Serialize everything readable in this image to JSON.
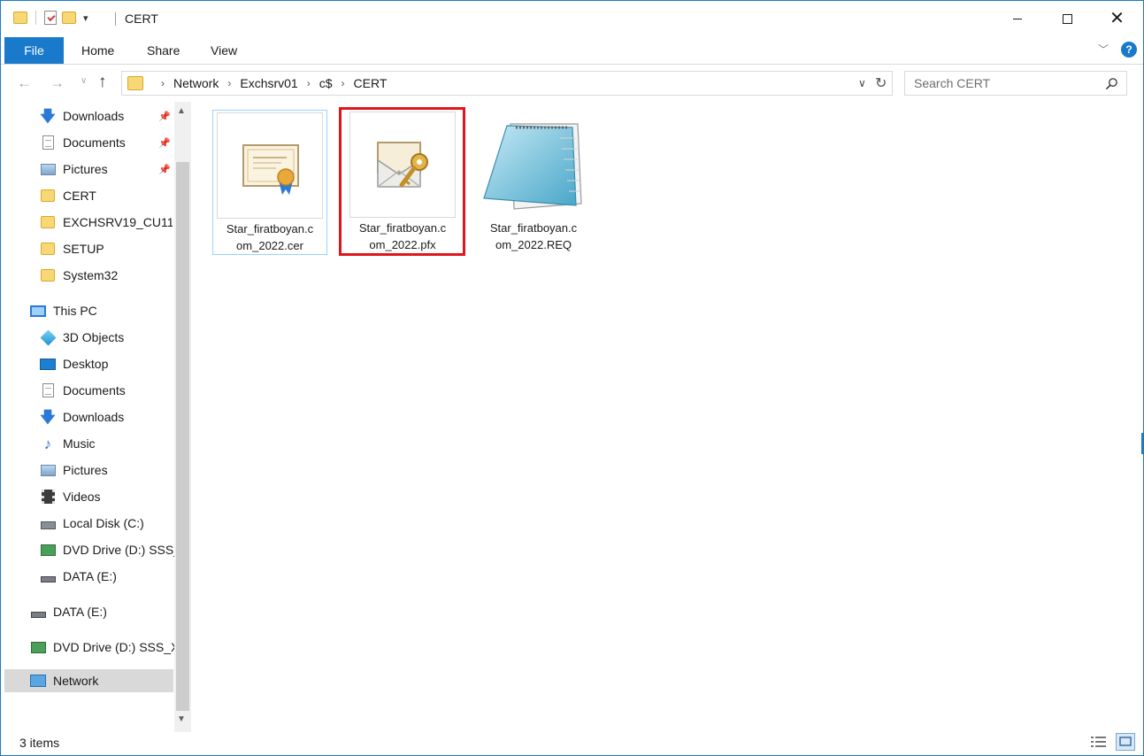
{
  "window": {
    "title": "CERT",
    "controls": {
      "minimize": "Minimize",
      "maximize": "Maximize",
      "close": "Close"
    }
  },
  "ribbon": {
    "tabs": [
      "File",
      "Home",
      "Share",
      "View"
    ],
    "accent_color": "#1979ca",
    "help_glyph": "?"
  },
  "address": {
    "crumbs": [
      "Network",
      "Exchsrv01",
      "c$",
      "CERT"
    ]
  },
  "search": {
    "placeholder": "Search CERT"
  },
  "nav": {
    "quick_access": [
      {
        "label": "Downloads",
        "icon": "downloads-icon",
        "pinned": true
      },
      {
        "label": "Documents",
        "icon": "documents-icon",
        "pinned": true
      },
      {
        "label": "Pictures",
        "icon": "pictures-icon",
        "pinned": true
      },
      {
        "label": "CERT",
        "icon": "folder-icon"
      },
      {
        "label": "EXCHSRV19_CU11",
        "icon": "folder-icon"
      },
      {
        "label": "SETUP",
        "icon": "folder-icon"
      },
      {
        "label": "System32",
        "icon": "folder-icon"
      }
    ],
    "this_pc": {
      "label": "This PC",
      "items": [
        {
          "label": "3D Objects",
          "icon": "3d-objects-icon"
        },
        {
          "label": "Desktop",
          "icon": "desktop-icon"
        },
        {
          "label": "Documents",
          "icon": "documents-icon"
        },
        {
          "label": "Downloads",
          "icon": "downloads-icon"
        },
        {
          "label": "Music",
          "icon": "music-icon"
        },
        {
          "label": "Pictures",
          "icon": "pictures-icon"
        },
        {
          "label": "Videos",
          "icon": "videos-icon"
        },
        {
          "label": "Local Disk (C:)",
          "icon": "local-disk-icon"
        },
        {
          "label": "DVD Drive (D:) SSS_",
          "icon": "dvd-drive-icon"
        },
        {
          "label": "DATA (E:)",
          "icon": "drive-icon"
        }
      ]
    },
    "data_drive": "DATA (E:)",
    "dvd_drive": "DVD Drive (D:) SSS_X",
    "network": "Network"
  },
  "files": [
    {
      "name": "Star_firatboyan.com_2022.cer",
      "line1": "Star_firatboyan.c",
      "line2": "om_2022.cer",
      "icon": "certificate-icon",
      "selected": true
    },
    {
      "name": "Star_firatboyan.com_2022.pfx",
      "line1": "Star_firatboyan.c",
      "line2": "om_2022.pfx",
      "icon": "pfx-key-icon",
      "highlighted": true
    },
    {
      "name": "Star_firatboyan.com_2022.REQ",
      "line1": "Star_firatboyan.c",
      "line2": "om_2022.REQ",
      "icon": "notepad-icon"
    }
  ],
  "highlight_color": "#e2141b",
  "status": {
    "item_count": "3 items"
  }
}
